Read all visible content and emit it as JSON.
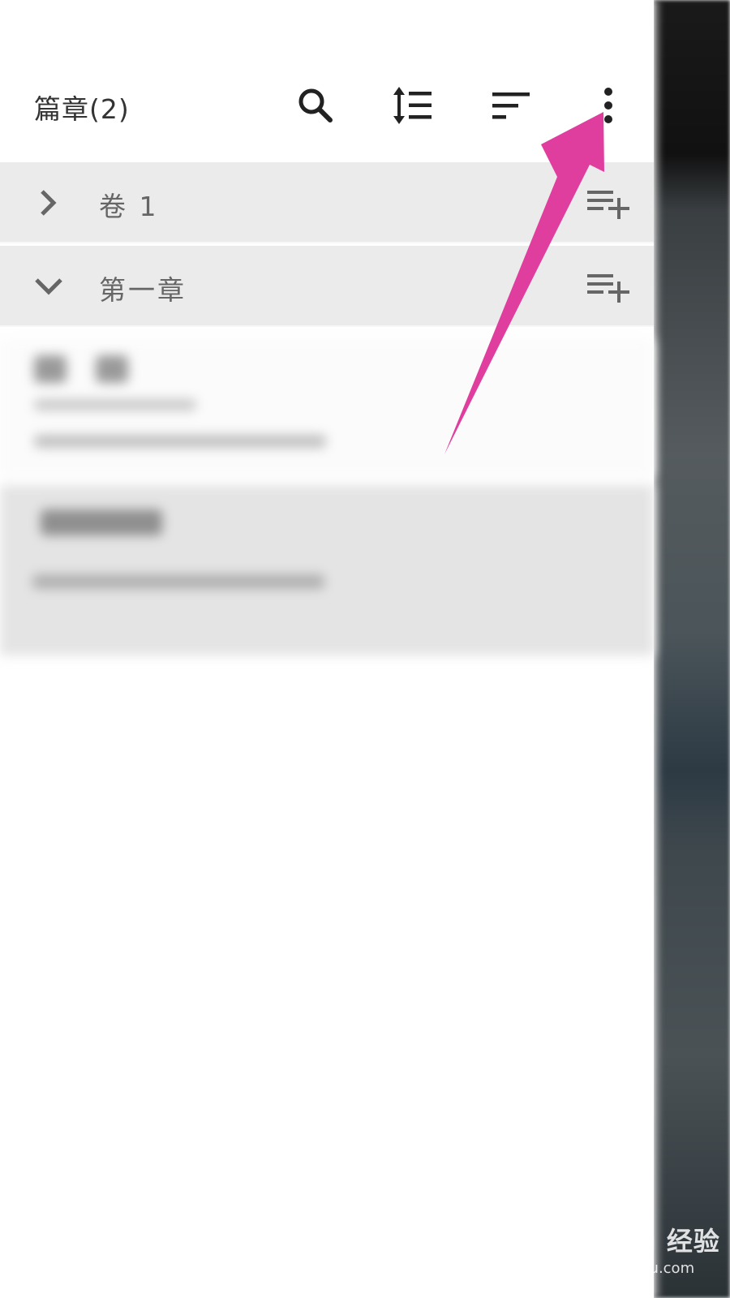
{
  "header": {
    "title": "篇章(2)",
    "icons": [
      "search-icon",
      "line-spacing-icon",
      "sort-icon",
      "more-vert-icon"
    ]
  },
  "rows": [
    {
      "label": "卷 1",
      "expanded": false,
      "chevron_icon": "chevron-right-icon",
      "action_icon": "playlist-add-icon"
    },
    {
      "label": "第一章",
      "expanded": true,
      "chevron_icon": "chevron-down-icon",
      "action_icon": "playlist-add-icon"
    }
  ],
  "watermark": {
    "brand": "Bai du 经验",
    "url": "jingyan.baidu.com"
  },
  "colors": {
    "annotation_arrow": "#e03e9e",
    "row_background": "#ebebeb",
    "icon_dark": "#222222",
    "icon_gray": "#666666"
  }
}
